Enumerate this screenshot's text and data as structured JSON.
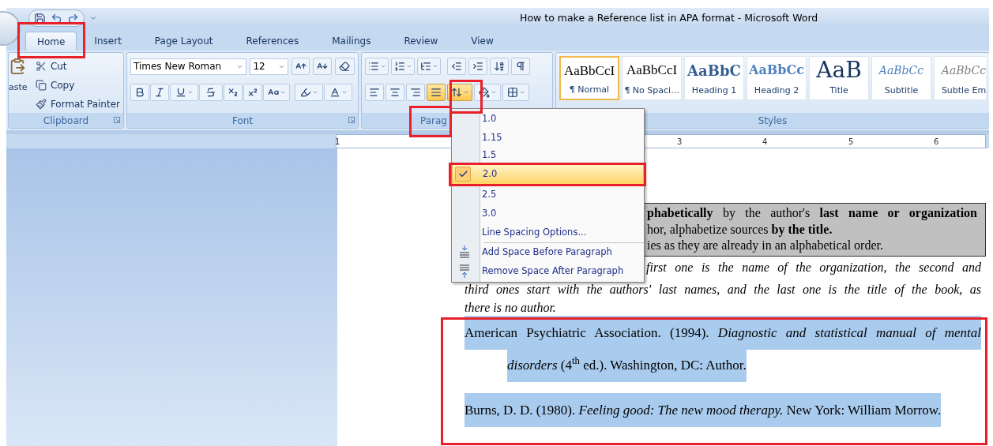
{
  "window": {
    "title": "How to make a Reference list in APA format - Microsoft Word"
  },
  "tabs": [
    {
      "label": "Home",
      "selected": true
    },
    {
      "label": "Insert",
      "selected": false
    },
    {
      "label": "Page Layout",
      "selected": false
    },
    {
      "label": "References",
      "selected": false
    },
    {
      "label": "Mailings",
      "selected": false
    },
    {
      "label": "Review",
      "selected": false
    },
    {
      "label": "View",
      "selected": false
    }
  ],
  "clipboard": {
    "label": "Clipboard",
    "paste_label": "aste",
    "items": [
      {
        "kind": "cut",
        "label": "Cut"
      },
      {
        "kind": "copy",
        "label": "Copy"
      },
      {
        "kind": "painter",
        "label": "Format Painter"
      }
    ]
  },
  "font": {
    "label": "Font",
    "font_name": "Times New Roman",
    "font_size": "12"
  },
  "paragraph": {
    "label": "Parag",
    "alignments": [
      {
        "kind": "left",
        "selected": false
      },
      {
        "kind": "center",
        "selected": false
      },
      {
        "kind": "right",
        "selected": false
      },
      {
        "kind": "justify",
        "selected": true
      }
    ],
    "line_spacing_open": true
  },
  "styles": {
    "label": "Styles",
    "items": [
      {
        "kind": "normal",
        "preview": "AaBbCcI",
        "name": "¶ Normal",
        "selected": true
      },
      {
        "kind": "normal",
        "preview": "AaBbCcI",
        "name": "¶ No Spaci...",
        "selected": false
      },
      {
        "kind": "heading1",
        "preview": "AaBbC",
        "name": "Heading 1",
        "selected": false
      },
      {
        "kind": "heading2",
        "preview": "AaBbCc",
        "name": "Heading 2",
        "selected": false
      },
      {
        "kind": "title",
        "preview": "AaB",
        "name": "Title",
        "selected": false
      },
      {
        "kind": "subtitle",
        "preview": "AaBbCc",
        "name": "Subtitle",
        "selected": false
      },
      {
        "kind": "subtle",
        "preview": "AaBbCc",
        "name": "Subtle Em",
        "selected": false
      }
    ]
  },
  "ruler": {
    "numbers": [
      "1",
      "3",
      "4",
      "5",
      "6"
    ]
  },
  "line_spacing_menu": {
    "items": [
      {
        "kind": "value",
        "label": "1.0",
        "selected": false
      },
      {
        "kind": "value",
        "label": "1.15",
        "selected": false
      },
      {
        "kind": "value",
        "label": "1.5",
        "selected": false
      },
      {
        "kind": "value",
        "label": "2.0",
        "selected": true
      },
      {
        "kind": "value",
        "label": "2.5",
        "selected": false
      },
      {
        "kind": "value",
        "label": "3.0",
        "selected": false
      },
      {
        "kind": "command",
        "label": "Line Spacing Options..."
      },
      {
        "kind": "space_before",
        "label": "Add Space Before Paragraph"
      },
      {
        "kind": "space_after",
        "label": "Remove Space After Paragraph"
      }
    ]
  },
  "document": {
    "boxed_lines": [
      "**phabetically** by the author's **last name or organization**",
      "hor, alphabetize sources **by the title.**",
      "ies as they are already in an alphabetical order."
    ],
    "note_lines": [
      "first one is the name of the organization, the second and",
      "third ones start with the authors' last names, and the last one is the title of the book, as",
      "there is no author."
    ],
    "references": [
      "American Psychiatric Association. (1994). *Diagnostic and statistical manual of mental disorders* (4$^{th}$ ed.). Washington, DC: Author.",
      "Burns, D. D. (1980). *Feeling good: The new mood therapy.* New York: William Morrow."
    ]
  }
}
